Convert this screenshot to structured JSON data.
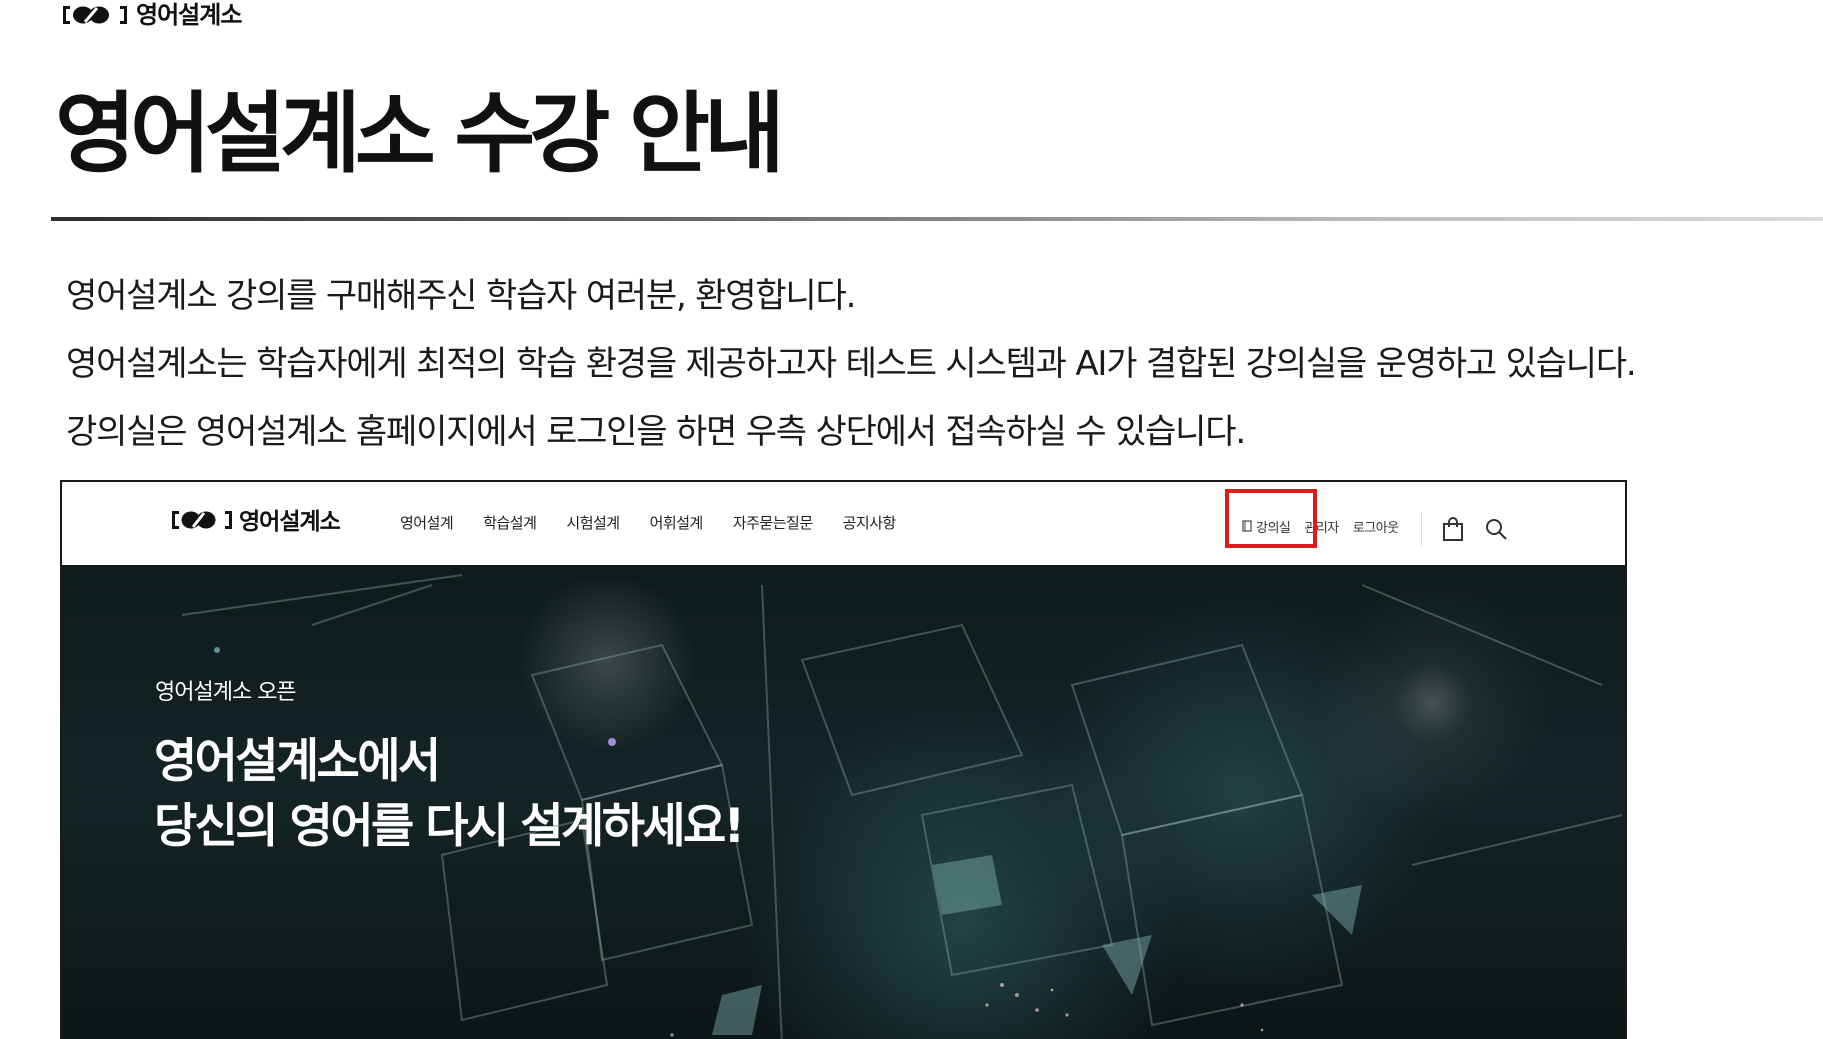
{
  "brand": {
    "name": "영어설계소",
    "logo_icon": "brand-logo-mark"
  },
  "page": {
    "title": "영어설계소 수강 안내"
  },
  "intro": {
    "lines": [
      "영어설계소 강의를 구매해주신 학습자 여러분, 환영합니다.",
      "영어설계소는 학습자에게 최적의 학습 환경을 제공하고자 테스트 시스템과 AI가 결합된 강의실을 운영하고 있습니다.",
      "강의실은 영어설계소 홈페이지에서 로그인을 하면 우측 상단에서 접속하실 수 있습니다."
    ]
  },
  "site": {
    "logo_text": "영어설계소",
    "nav": [
      "영어설계",
      "학습설계",
      "시험설계",
      "어휘설계",
      "자주묻는질문",
      "공지사항"
    ],
    "util": {
      "classroom": "강의실",
      "admin": "관리자",
      "logout": "로그아웃",
      "classroom_icon": "book-icon",
      "cart_icon": "shopping-bag-icon",
      "search_icon": "search-icon"
    },
    "highlight_color": "#e01a1a"
  },
  "hero": {
    "eyebrow": "영어설계소 오픈",
    "headline_line1": "영어설계소에서",
    "headline_line2": "당신의 영어를 다시 설계하세요!"
  }
}
